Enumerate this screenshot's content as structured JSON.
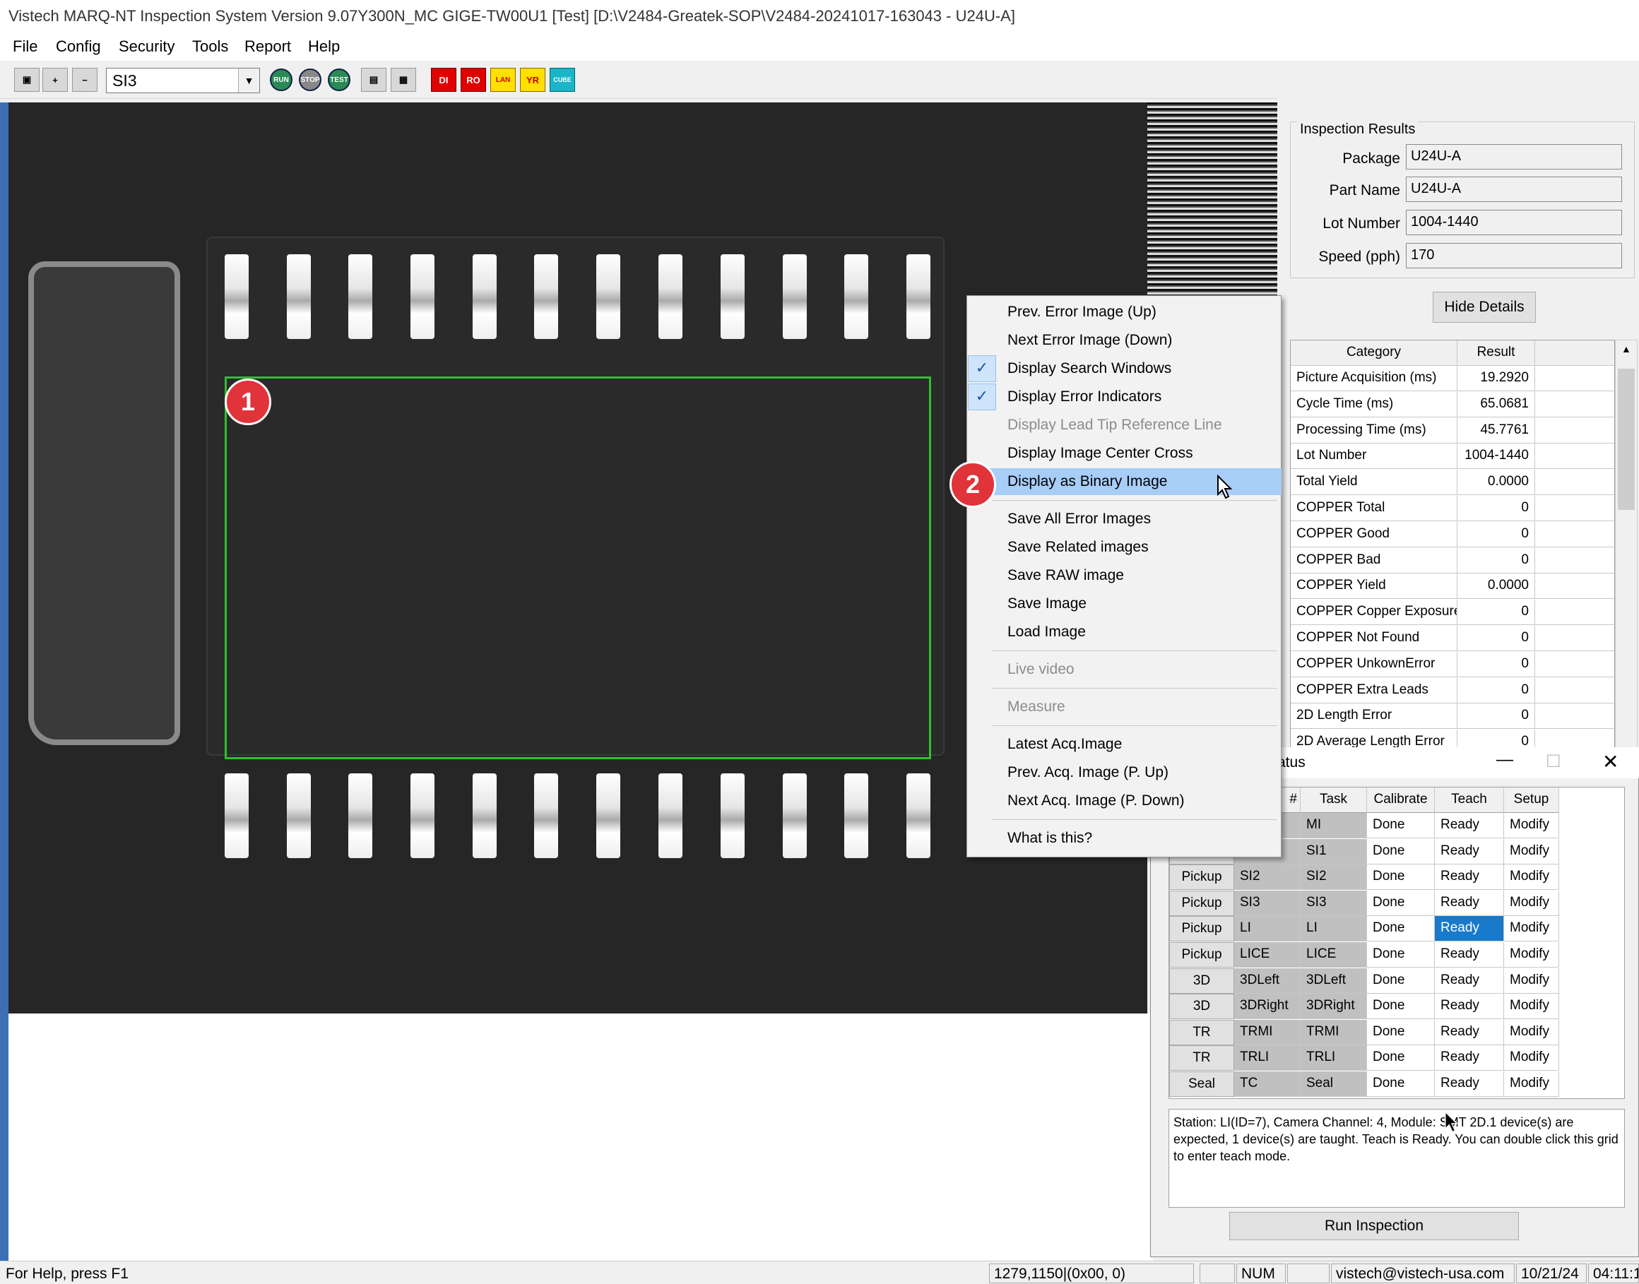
{
  "app": {
    "title": "Vistech MARQ-NT Inspection System Version 9.07Y300N_MC GIGE-TW00U1 [Test] [D:\\V2484-Greatek-SOP\\V2484-20241017-163043 - U24U-A]"
  },
  "menu": [
    "File",
    "Config",
    "Security",
    "Tools",
    "Report",
    "Help"
  ],
  "toolbar": {
    "station_select": "SI3",
    "run_label": "RUN",
    "stop_label": "STOP",
    "test_label": "TEST",
    "di_label": "DI",
    "ro_label": "RO",
    "lan_label": "LAN",
    "yr_label": "YR",
    "cube_label": "CUBE"
  },
  "annotations": {
    "badge1": "1",
    "badge2": "2"
  },
  "inspection_results": {
    "legend": "Inspection Results",
    "package_label": "Package",
    "package_value": "U24U-A",
    "partname_label": "Part Name",
    "partname_value": "U24U-A",
    "lot_label": "Lot Number",
    "lot_value": "1004-1440",
    "speed_label": "Speed (pph)",
    "speed_value": "170",
    "hide_details": "Hide Details"
  },
  "results_table": {
    "headers": [
      "Category",
      "Result"
    ],
    "rows": [
      [
        "Picture Acquisition (ms)",
        "19.2920"
      ],
      [
        "Cycle Time (ms)",
        "65.0681"
      ],
      [
        "Processing Time (ms)",
        "45.7761"
      ],
      [
        "Lot Number",
        "1004-1440"
      ],
      [
        "Total Yield",
        "0.0000"
      ],
      [
        "COPPER Total",
        "0"
      ],
      [
        "COPPER Good",
        "0"
      ],
      [
        "COPPER Bad",
        "0"
      ],
      [
        "COPPER Yield",
        "0.0000"
      ],
      [
        "COPPER Copper Exposure",
        "0"
      ],
      [
        "COPPER Not Found",
        "0"
      ],
      [
        "COPPER UnkownError",
        "0"
      ],
      [
        "COPPER Extra Leads",
        "0"
      ],
      [
        "2D Length Error",
        "0"
      ],
      [
        "2D Average Length Error",
        "0"
      ]
    ]
  },
  "context_menu": {
    "prev_error": "Prev. Error Image (Up)",
    "next_error": "Next Error Image (Down)",
    "display_search": "Display Search Windows",
    "display_error_ind": "Display Error Indicators",
    "display_lead_tip": "Display Lead Tip Reference Line",
    "display_center_cross": "Display Image Center Cross",
    "display_binary": "Display as Binary Image",
    "save_all_error": "Save All Error Images",
    "save_related": "Save Related images",
    "save_raw": "Save RAW image",
    "save_image": "Save Image",
    "load_image": "Load Image",
    "live_video": "Live video",
    "measure": "Measure",
    "latest_acq": "Latest Acq.Image",
    "prev_acq": "Prev. Acq. Image (P. Up)",
    "next_acq": "Next Acq. Image (P. Down)",
    "what_is_this": "What is this?"
  },
  "status_window": {
    "title": "atus",
    "headers": [
      "#",
      "Task",
      "Calibrate",
      "Teach",
      "Setup"
    ],
    "rows": [
      {
        "btn": "",
        "station": "",
        "task": "MI",
        "cal": "Done",
        "teach": "Ready",
        "setup": "Modify"
      },
      {
        "btn": "",
        "station": "",
        "task": "SI1",
        "cal": "Done",
        "teach": "Ready",
        "setup": "Modify"
      },
      {
        "btn": "Pickup",
        "station": "SI2",
        "task": "SI2",
        "cal": "Done",
        "teach": "Ready",
        "setup": "Modify"
      },
      {
        "btn": "Pickup",
        "station": "SI3",
        "task": "SI3",
        "cal": "Done",
        "teach": "Ready",
        "setup": "Modify"
      },
      {
        "btn": "Pickup",
        "station": "LI",
        "task": "LI",
        "cal": "Done",
        "teach": "Ready",
        "setup": "Modify"
      },
      {
        "btn": "Pickup",
        "station": "LICE",
        "task": "LICE",
        "cal": "Done",
        "teach": "Ready",
        "setup": "Modify"
      },
      {
        "btn": "3D",
        "station": "3DLeft",
        "task": "3DLeft",
        "cal": "Done",
        "teach": "Ready",
        "setup": "Modify"
      },
      {
        "btn": "3D",
        "station": "3DRight",
        "task": "3DRight",
        "cal": "Done",
        "teach": "Ready",
        "setup": "Modify"
      },
      {
        "btn": "TR",
        "station": "TRMI",
        "task": "TRMI",
        "cal": "Done",
        "teach": "Ready",
        "setup": "Modify"
      },
      {
        "btn": "TR",
        "station": "TRLI",
        "task": "TRLI",
        "cal": "Done",
        "teach": "Ready",
        "setup": "Modify"
      },
      {
        "btn": "Seal",
        "station": "TC",
        "task": "Seal",
        "cal": "Done",
        "teach": "Ready",
        "setup": "Modify"
      }
    ],
    "description": "Station: LI(ID=7), Camera Channel: 4, Module: SMT 2D.1 device(s) are expected, 1 device(s) are taught. Teach is Ready. You can double click this grid to enter teach mode.",
    "run_inspection": "Run Inspection"
  },
  "statusbar": {
    "help": "For Help, press F1",
    "coords": "1279,1150|(0x00,   0)",
    "num": "NUM",
    "email": "vistech@vistech-usa.com",
    "date": "10/21/24",
    "time": "04:11:1"
  },
  "colors": {
    "accent": "#1979ca",
    "highlight": "#a8cdf7",
    "search_window": "#2fbf2f",
    "badge": "#e0333a"
  }
}
